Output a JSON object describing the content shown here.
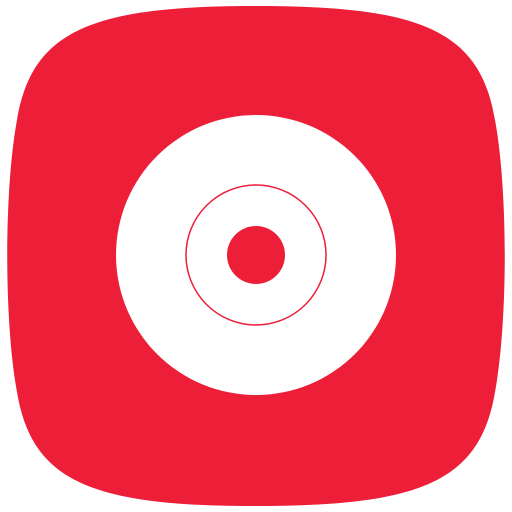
{
  "icon": {
    "semantic": "music-disc-app-icon",
    "background_color": "#ffffff",
    "tile_color": "#ec1e38",
    "disc_color": "#ffffff",
    "groove_color": "#ec1e38",
    "hub_color": "#ec1e38"
  }
}
